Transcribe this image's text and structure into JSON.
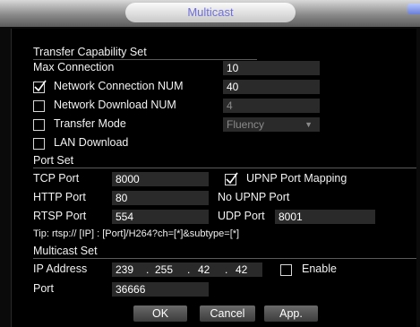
{
  "window": {
    "title": "Multicast"
  },
  "transfer": {
    "section_title": "Transfer Capability Set",
    "max_connection_label": "Max Connection",
    "max_connection_value": "10",
    "net_conn_label": "Network Connection NUM",
    "net_conn_value": "40",
    "net_conn_checked": true,
    "net_down_label": "Network Download NUM",
    "net_down_value": "4",
    "net_down_checked": false,
    "mode_label": "Transfer Mode",
    "mode_value": "Fluency",
    "mode_checked": false,
    "lan_label": "LAN Download",
    "lan_checked": false
  },
  "ports": {
    "section_title": "Port Set",
    "tcp_label": "TCP Port",
    "tcp_value": "8000",
    "upnp_label": "UPNP Port Mapping",
    "upnp_checked": true,
    "http_label": "HTTP Port",
    "http_value": "80",
    "no_upnp_label": "No UPNP Port",
    "rtsp_label": "RTSP Port",
    "rtsp_value": "554",
    "udp_label": "UDP Port",
    "udp_value": "8001",
    "tip": "Tip:  rtsp:// [IP] : [Port]/H264?ch=[*]&subtype=[*]"
  },
  "multicast": {
    "section_title": "Multicast Set",
    "ip_label": "IP Address",
    "ip": [
      "239",
      "255",
      "42",
      "42"
    ],
    "enable_label": "Enable",
    "enable_checked": false,
    "port_label": "Port",
    "port_value": "36666"
  },
  "buttons": {
    "ok": "OK",
    "cancel": "Cancel",
    "apply": "App."
  }
}
